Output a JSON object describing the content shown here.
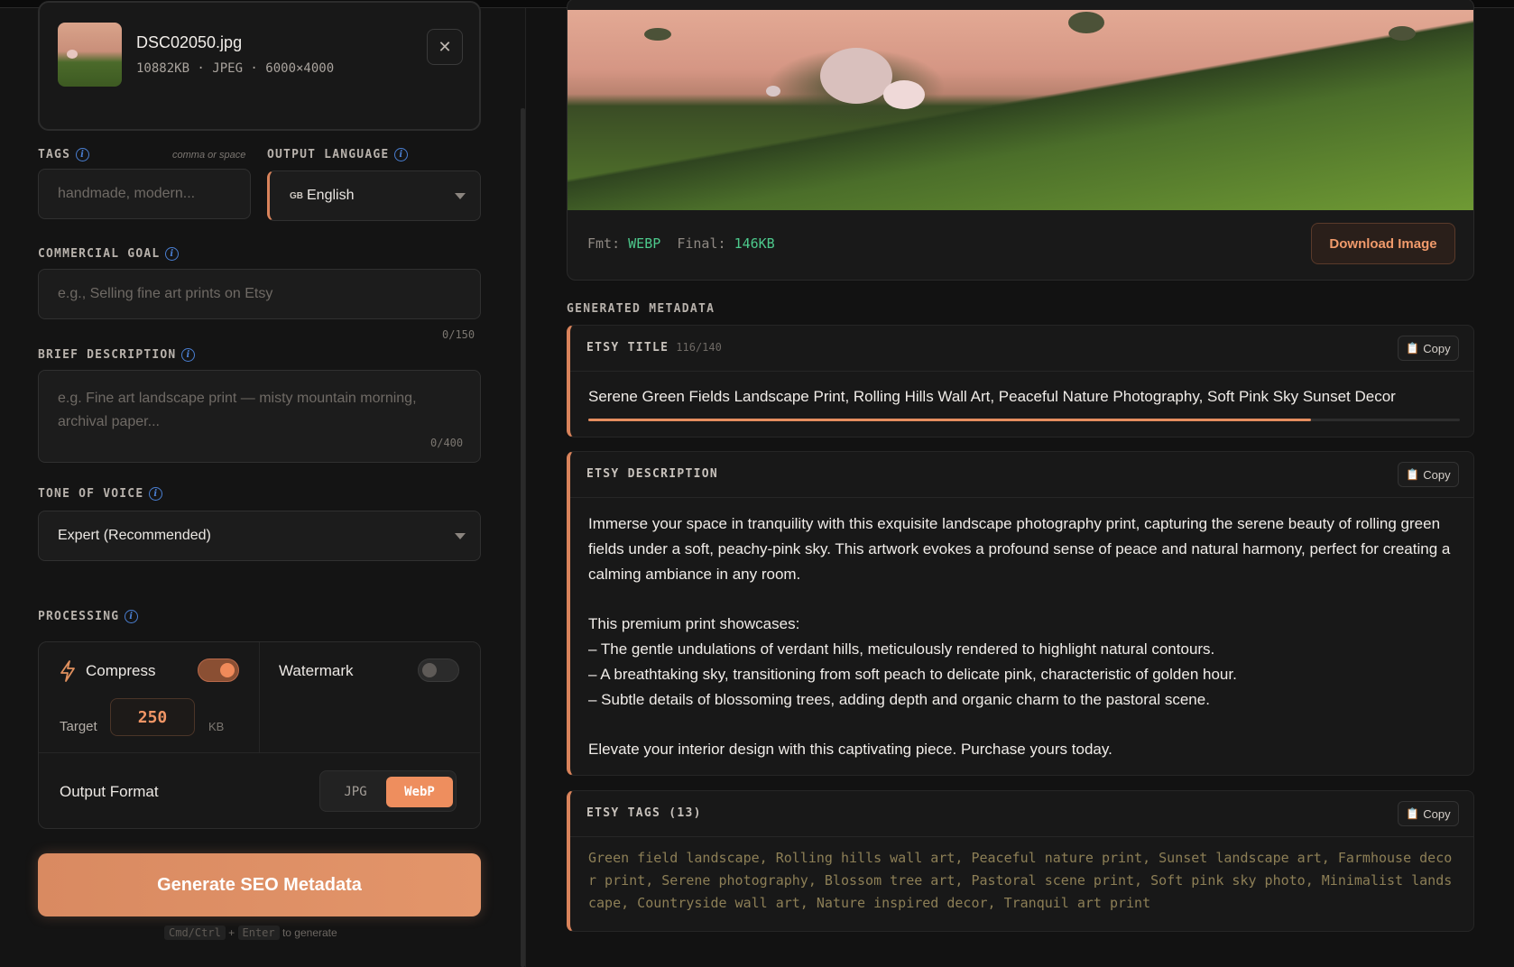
{
  "file": {
    "name": "DSC02050.jpg",
    "meta": "10882KB · JPEG · 6000×4000",
    "close_glyph": "✕"
  },
  "form": {
    "tags": {
      "label": "TAGS",
      "hint": "comma or space",
      "placeholder": "handmade, modern..."
    },
    "output_language": {
      "label": "OUTPUT LANGUAGE",
      "flag": "GB",
      "value": "English"
    },
    "commercial_goal": {
      "label": "COMMERCIAL GOAL",
      "placeholder": "e.g., Selling fine art prints on Etsy",
      "counter": "0/150"
    },
    "brief_description": {
      "label": "BRIEF DESCRIPTION",
      "placeholder": "e.g. Fine art landscape print — misty mountain morning, archival paper...",
      "counter": "0/400"
    },
    "tone_of_voice": {
      "label": "TONE OF VOICE",
      "value": "Expert (Recommended)"
    }
  },
  "processing": {
    "label": "PROCESSING",
    "compress": {
      "label": "Compress",
      "enabled": true
    },
    "watermark": {
      "label": "Watermark",
      "enabled": false
    },
    "target": {
      "label": "Target",
      "value": "250",
      "unit": "KB"
    },
    "output_format": {
      "label": "Output Format",
      "options": [
        "JPG",
        "WebP"
      ],
      "selected": "WebP"
    }
  },
  "generate": {
    "button": "Generate SEO Metadata",
    "hint_key1": "Cmd/Ctrl",
    "hint_plus": "+",
    "hint_key2": "Enter",
    "hint_text": "to generate"
  },
  "preview": {
    "fmt_label": "Fmt:",
    "fmt_value": "WEBP",
    "final_label": "Final:",
    "final_value": "146KB",
    "download_button": "Download Image"
  },
  "metadata": {
    "section_title": "GENERATED METADATA",
    "copy_label": "Copy",
    "title_card": {
      "label": "ETSY TITLE",
      "count": "116/140",
      "text": "Serene Green Fields Landscape Print, Rolling Hills Wall Art, Peaceful Nature Photography, Soft Pink Sky Sunset Decor",
      "fill_fraction": 0.829
    },
    "description_card": {
      "label": "ETSY DESCRIPTION",
      "p1": "Immerse your space in tranquility with this exquisite landscape photography print, capturing the serene beauty of rolling green fields under a soft, peachy-pink sky. This artwork evokes a profound sense of peace and natural harmony, perfect for creating a calming ambiance in any room.",
      "p2": "This premium print showcases:",
      "b1": "– The gentle undulations of verdant hills, meticulously rendered to highlight natural contours.",
      "b2": "– A breathtaking sky, transitioning from soft peach to delicate pink, characteristic of golden hour.",
      "b3": "– Subtle details of blossoming trees, adding depth and organic charm to the pastoral scene.",
      "p3": "Elevate your interior design with this captivating piece. Purchase yours today."
    },
    "tags_card": {
      "label": "ETSY TAGS (13)",
      "text": "Green field landscape, Rolling hills wall art, Peaceful nature print, Sunset landscape art, Farmhouse decor print, Serene photography, Blossom tree art, Pastoral scene print, Soft pink sky photo, Minimalist landscape, Countryside wall art, Nature inspired decor, Tranquil art print"
    }
  },
  "colors": {
    "accent": "#e58d5f",
    "background": "#121212",
    "green_value": "#4dc98c",
    "info_blue": "#4a7fd2"
  }
}
